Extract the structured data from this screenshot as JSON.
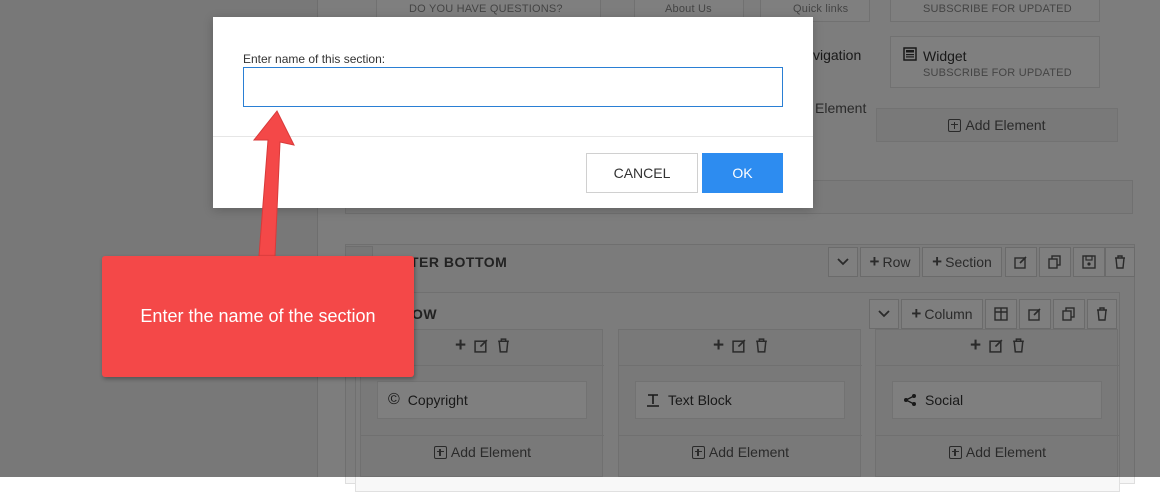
{
  "background": {
    "top_cards": {
      "card1_sub": "DO YOU HAVE QUESTIONS?",
      "card2_sub": "About Us",
      "card3_sub": "Quick links",
      "card4_sub": "SUBSCRIBE FOR UPDATED",
      "navigation_partial": "vigation",
      "widget_title": "Widget",
      "widget_sub": "SUBSCRIBE FOR UPDATED",
      "add_element_partial": "Element",
      "add_element": "Add Element"
    },
    "footer_section": {
      "title_partial": "TER BOTTOM",
      "row_button": "Row",
      "section_button": "Section",
      "row_label_partial": "OW",
      "column_button": "Column"
    },
    "columns": [
      {
        "element": "Copyright",
        "add_element": "Add Element"
      },
      {
        "element": "Text Block",
        "add_element": "Add Element"
      },
      {
        "element": "Social",
        "add_element": "Add Element"
      }
    ]
  },
  "dialog": {
    "label": "Enter name of this section:",
    "input_value": "",
    "cancel_label": "CANCEL",
    "ok_label": "OK"
  },
  "callout": {
    "text": "Enter the name of the section",
    "color": "#f44848"
  },
  "colors": {
    "primary": "#2d8cf0",
    "overlay": "rgba(0,0,0,0.5)"
  }
}
